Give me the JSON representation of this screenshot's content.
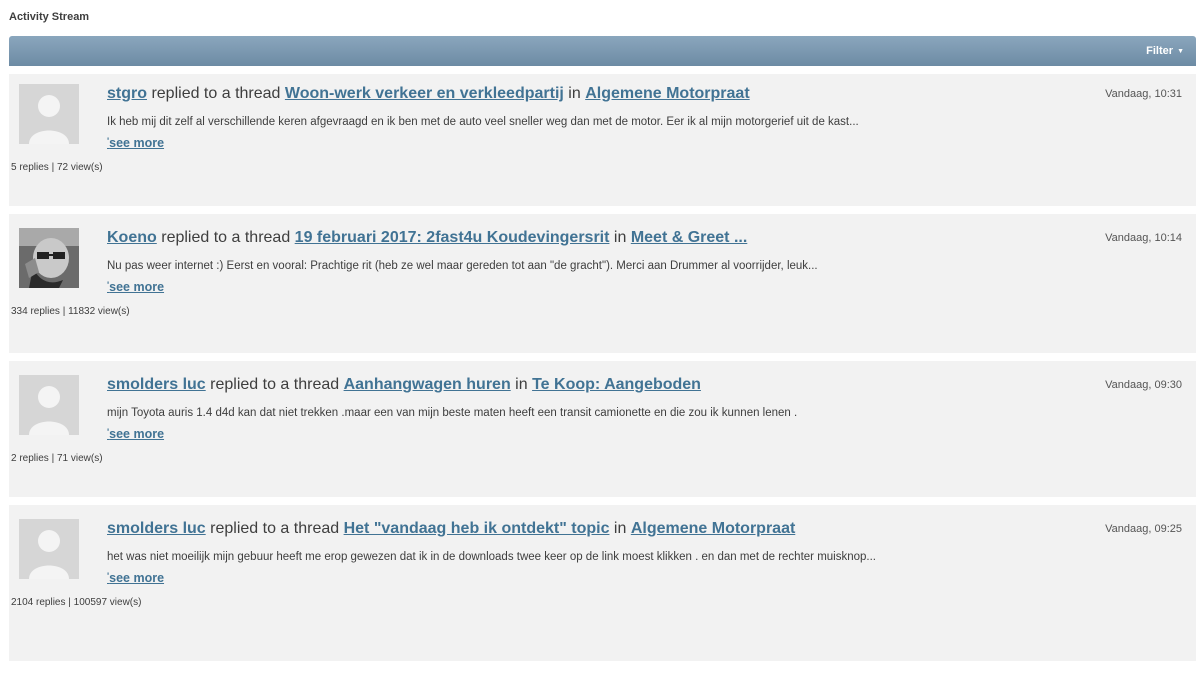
{
  "header": {
    "title": "Activity Stream",
    "filter_label": "Filter"
  },
  "colors": {
    "accent": "#417394",
    "toolbar": "#7896ae",
    "item_bg": "#f2f2f2"
  },
  "activities": [
    {
      "user": "stgro",
      "verb": "replied to a thread",
      "thread": "Woon-werk verkeer en verkleedpartij",
      "prep": "in",
      "forum": "Algemene Motorpraat",
      "time": "Vandaag, 10:31",
      "excerpt": "Ik heb mij dit zelf al verschillende keren afgevraagd en ik ben met de auto veel sneller weg dan met de motor. Eer ik al mijn motorgerief uit de kast...",
      "see_more": "see more",
      "stats": "5 replies | 72 view(s)",
      "avatar": "default-avatar-icon"
    },
    {
      "user": "Koeno",
      "verb": "replied to a thread",
      "thread": "19 februari 2017: 2fast4u Koudevingersrit",
      "prep": "in",
      "forum": "Meet & Greet ...",
      "time": "Vandaag, 10:14",
      "excerpt": "Nu pas weer internet :) Eerst en vooral: Prachtige rit (heb ze wel maar gereden tot aan \"de gracht\"). Merci aan Drummer al voorrijder, leuk...",
      "see_more": "see more",
      "stats": "334 replies | 11832 view(s)",
      "avatar": "user-photo"
    },
    {
      "user": "smolders luc",
      "verb": "replied to a thread",
      "thread": "Aanhangwagen huren",
      "prep": "in",
      "forum": "Te Koop: Aangeboden",
      "time": "Vandaag, 09:30",
      "excerpt": "mijn Toyota auris 1.4 d4d kan dat niet trekken .maar een van mijn beste maten heeft een transit camionette en die zou ik kunnen lenen .",
      "see_more": "see more",
      "stats": "2 replies | 71 view(s)",
      "avatar": "default-avatar-icon"
    },
    {
      "user": "smolders luc",
      "verb": "replied to a thread",
      "thread": "Het \"vandaag heb ik ontdekt\" topic",
      "prep": "in",
      "forum": "Algemene Motorpraat",
      "time": "Vandaag, 09:25",
      "excerpt": "het was niet moeilijk mijn gebuur heeft me erop gewezen dat ik in de downloads twee keer op de link moest klikken . en dan met de rechter muisknop...",
      "see_more": "see more",
      "stats": "2104 replies | 100597 view(s)",
      "avatar": "default-avatar-icon"
    }
  ]
}
